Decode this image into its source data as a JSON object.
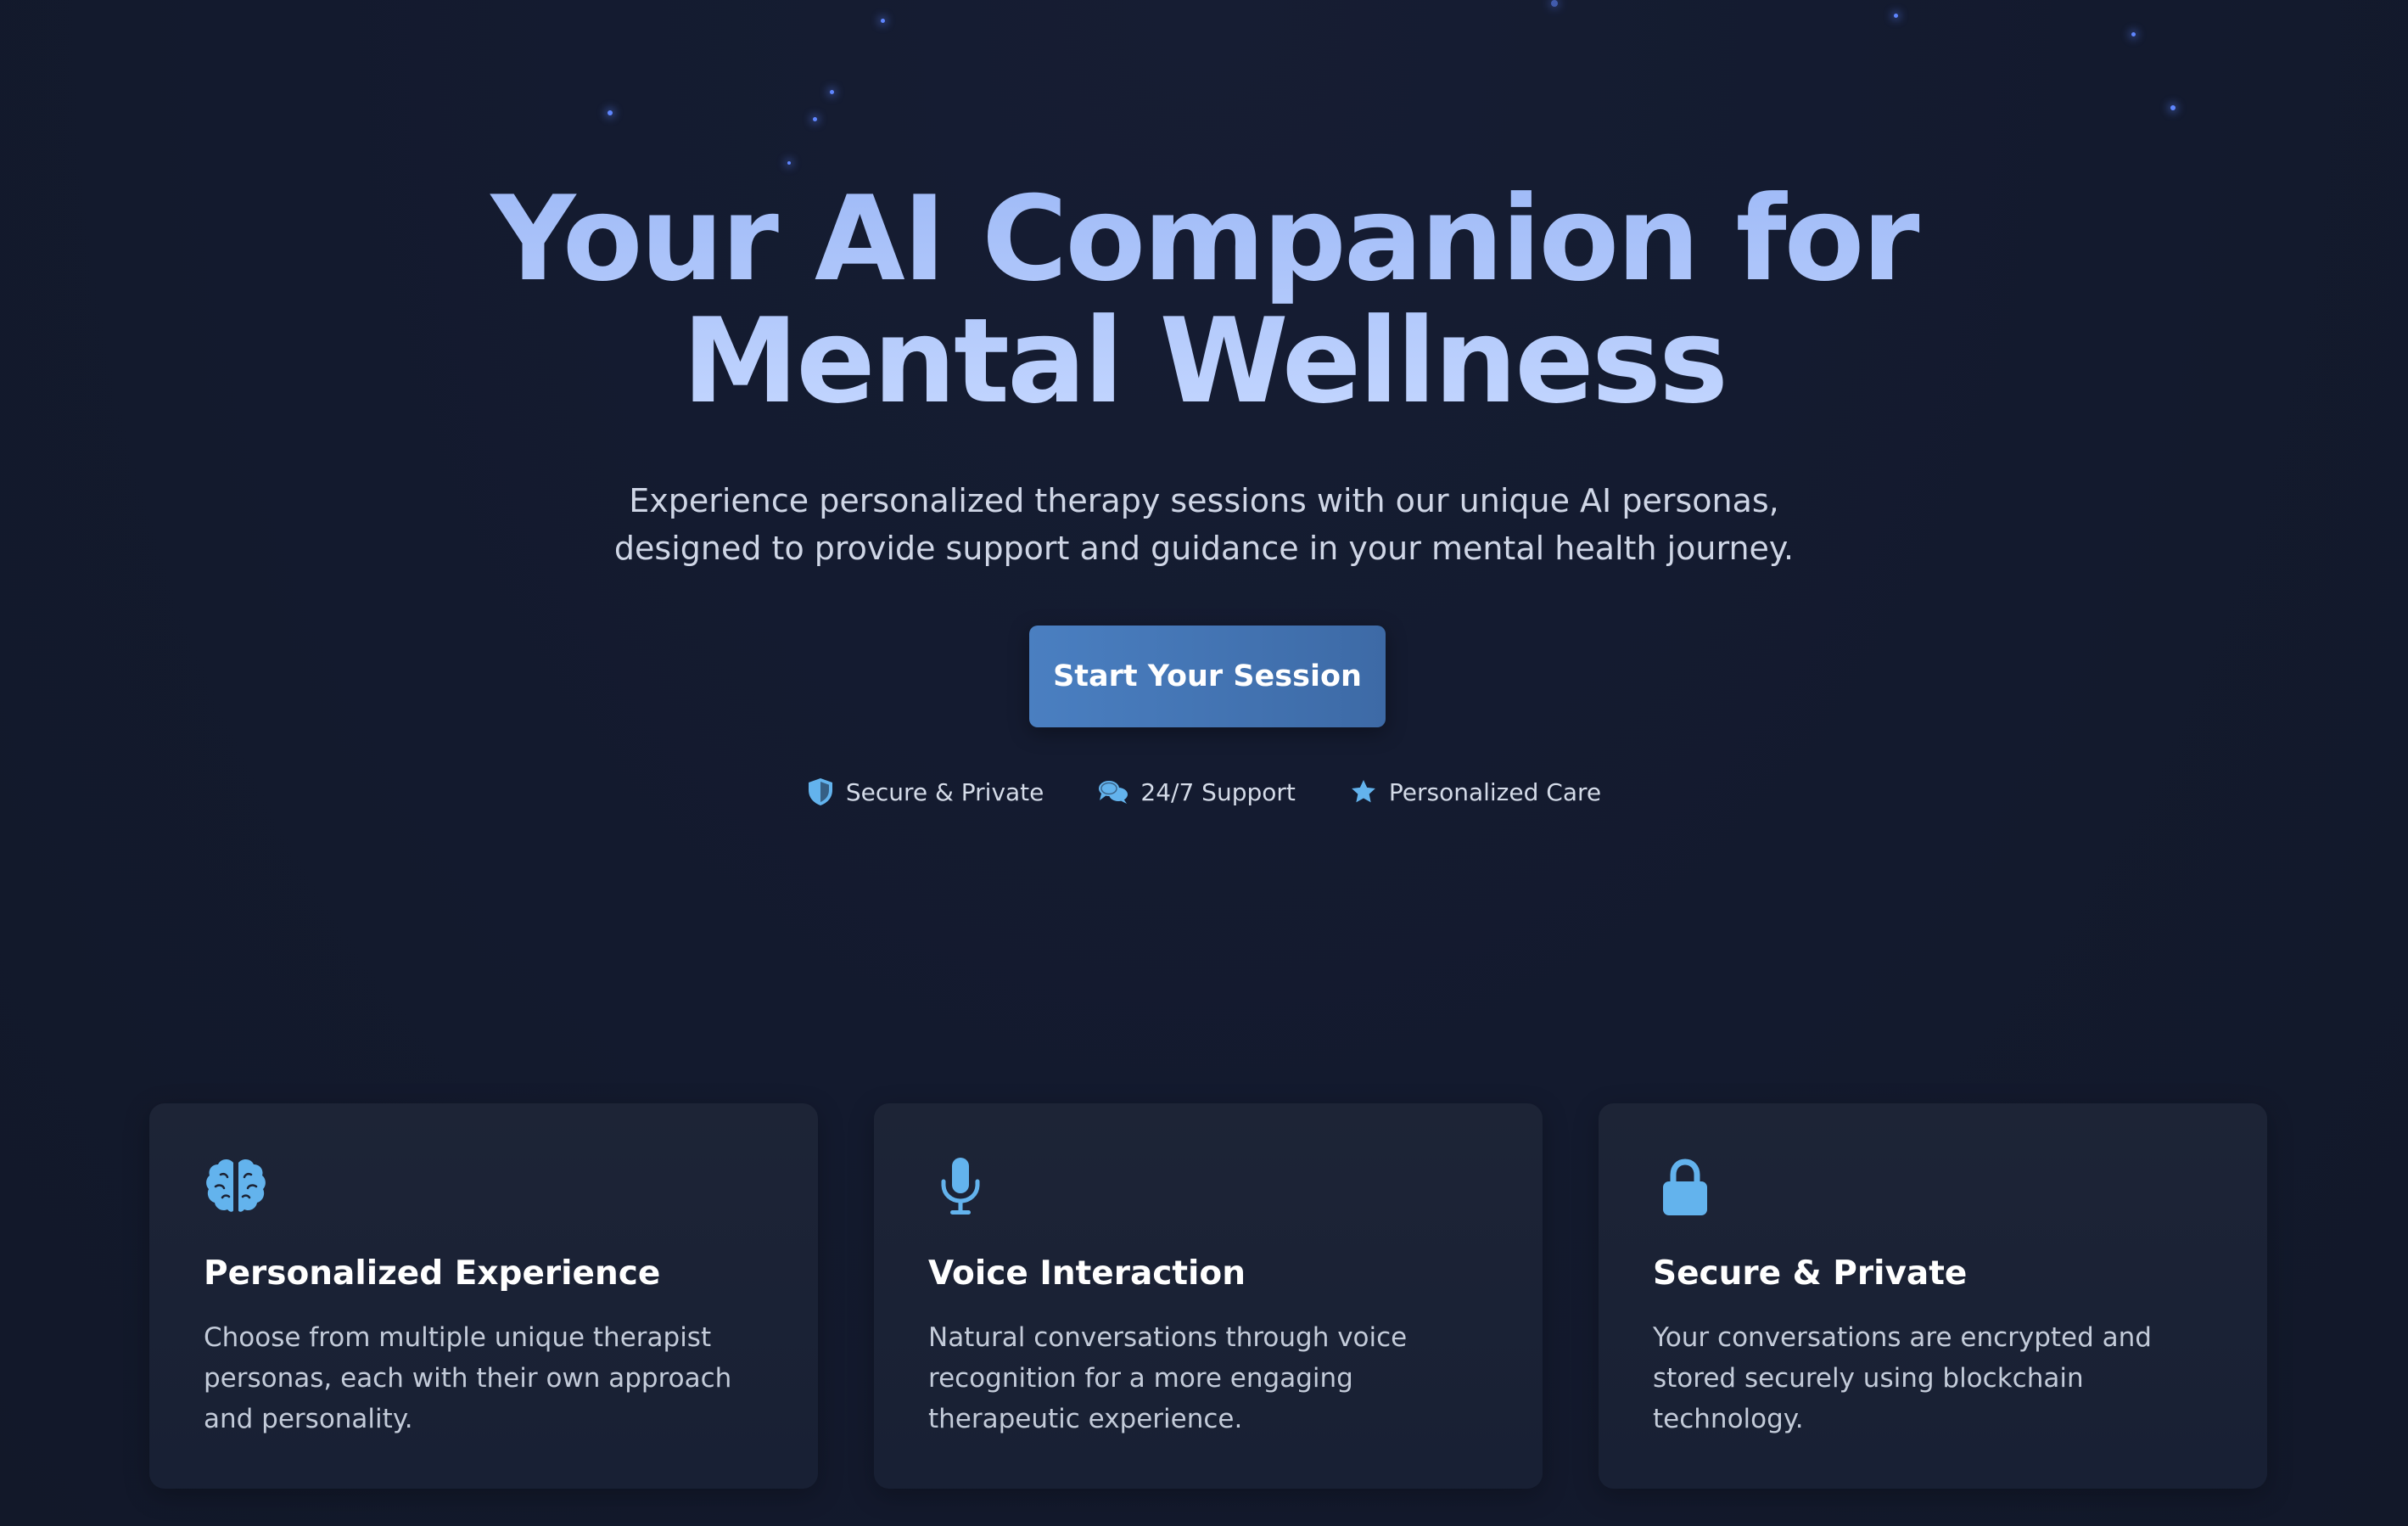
{
  "hero": {
    "title_line1": "Your AI Companion for",
    "title_line2": "Mental Wellness",
    "subtitle_line1": "Experience personalized therapy sessions with our unique AI personas,",
    "subtitle_line2": "designed to provide support and guidance in your mental health journey.",
    "cta_label": "Start Your Session"
  },
  "features": [
    {
      "label": "Secure & Private",
      "icon": "shield-icon"
    },
    {
      "label": "24/7 Support",
      "icon": "chat-bubbles-icon"
    },
    {
      "label": "Personalized Care",
      "icon": "star-icon"
    }
  ],
  "cards": [
    {
      "icon": "brain-icon",
      "title": "Personalized Experience",
      "text": "Choose from multiple unique therapist personas, each with their own approach and personality."
    },
    {
      "icon": "microphone-icon",
      "title": "Voice Interaction",
      "text": "Natural conversations through voice recognition for a more engaging therapeutic experience."
    },
    {
      "icon": "lock-icon",
      "title": "Secure & Private",
      "text": "Your conversations are encrypted and stored securely using blockchain technology."
    }
  ],
  "colors": {
    "background": "#131a2e",
    "accent": "#63b3ed",
    "title_gradient_start": "#9fbaf7",
    "title_gradient_end": "#c3d6ff",
    "button": "#4a7fc1",
    "card": "#1c2335"
  }
}
